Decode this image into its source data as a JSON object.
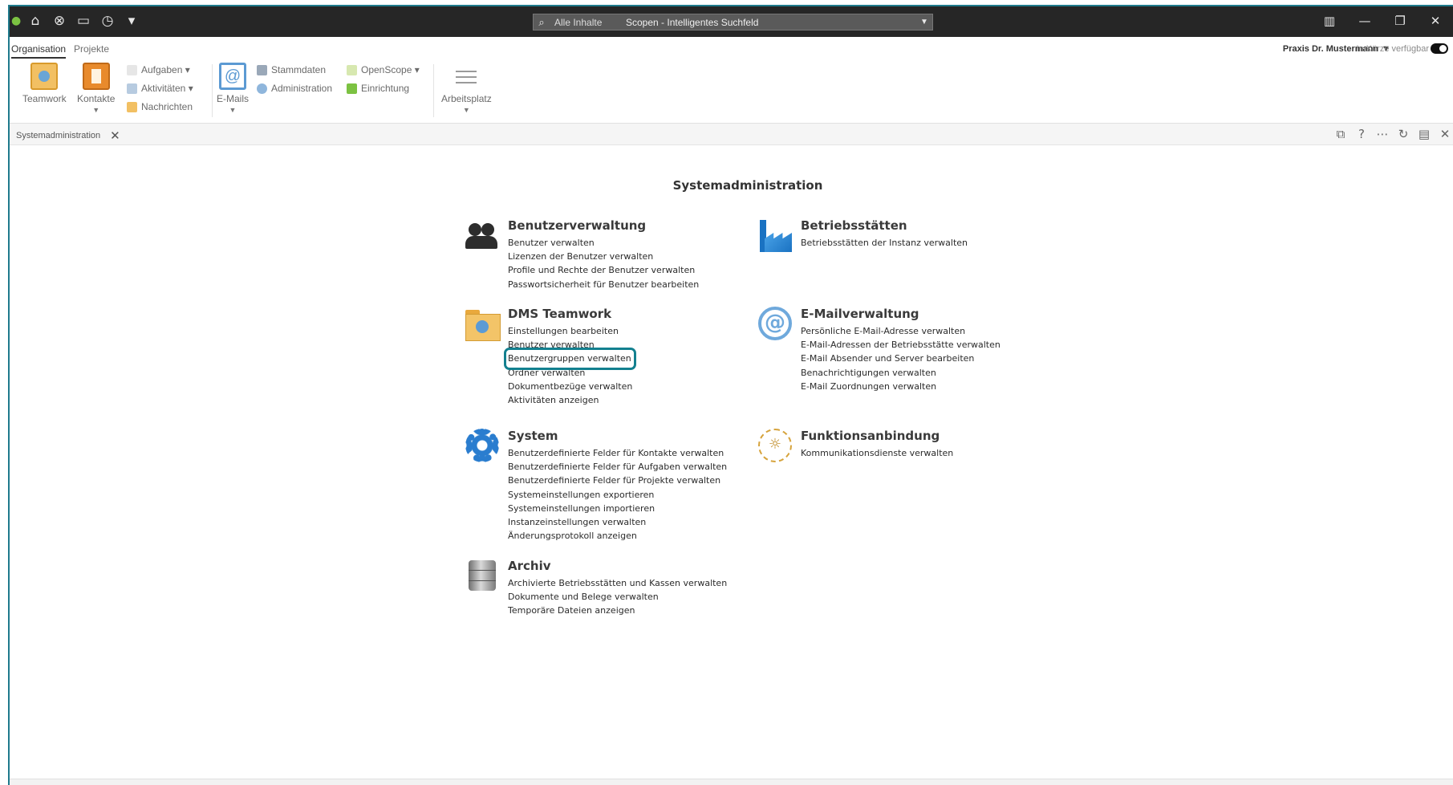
{
  "titlebar": {
    "quick_access_icons": [
      "user-status-icon",
      "home-icon",
      "support-icon",
      "chat-icon",
      "clock-icon",
      "customize-icon"
    ],
    "search": {
      "scope": "Alle Inhalte",
      "placeholder": "Scopen - Intelligentes Suchfeld"
    },
    "window_controls": [
      "layout-icon",
      "minimize-icon",
      "restore-icon",
      "close-icon"
    ]
  },
  "ribbon_tabs": {
    "organisation": "Organisation",
    "projekte": "Projekte"
  },
  "user": {
    "name": "Praxis Dr. Mustermann",
    "caret": "▼",
    "availability": "In Kürze verfügbar"
  },
  "ribbon": {
    "teamwork": "Teamwork",
    "kontakte": "Kontakte",
    "aufgaben": "Aufgaben ▾",
    "aktivitaeten": "Aktivitäten ▾",
    "nachrichten": "Nachrichten",
    "email": "E-Mails",
    "stammdaten": "Stammdaten",
    "administration": "Administration",
    "openscope": "OpenScope ▾",
    "einrichtung": "Einrichtung",
    "arbeitsplatz": "Arbeitsplatz"
  },
  "doctab": {
    "label": "Systemadministration"
  },
  "main": {
    "title": "Systemadministration",
    "sections": [
      {
        "title": "Benutzerverwaltung",
        "icon": "users-icon",
        "items": [
          "Benutzer verwalten",
          "Lizenzen der Benutzer verwalten",
          "Profile und Rechte der Benutzer verwalten",
          "Passwortsicherheit für Benutzer bearbeiten"
        ]
      },
      {
        "title": "Betriebsstätten",
        "icon": "factory-icon",
        "items": [
          "Betriebsstätten der Instanz verwalten"
        ]
      },
      {
        "title": "DMS Teamwork",
        "icon": "folder-icon",
        "items": [
          "Einstellungen bearbeiten",
          "Benutzer verwalten",
          "Benutzergruppen verwalten",
          "Ordner verwalten",
          "Dokumentbezüge verwalten",
          "Aktivitäten anzeigen"
        ]
      },
      {
        "title": "E-Mailverwaltung",
        "icon": "at-icon",
        "items": [
          "Persönliche E-Mail-Adresse verwalten",
          "E-Mail-Adressen der Betriebsstätte verwalten",
          "E-Mail Absender und Server bearbeiten",
          "Benachrichtigungen verwalten",
          "E-Mail Zuordnungen verwalten"
        ]
      },
      {
        "title": "System",
        "icon": "gear-icon",
        "items": [
          "Benutzerdefinierte Felder für Kontakte verwalten",
          "Benutzerdefinierte Felder für Aufgaben verwalten",
          "Benutzerdefinierte Felder für Projekte verwalten",
          "Systemeinstellungen exportieren",
          "Systemeinstellungen importieren",
          "Instanzeinstellungen verwalten",
          "Änderungsprotokoll anzeigen"
        ]
      },
      {
        "title": "Funktionsanbindung",
        "icon": "plug-icon",
        "items": [
          "Kommunikationsdienste verwalten"
        ]
      },
      {
        "title": "Archiv",
        "icon": "archive-icon",
        "items": [
          "Archivierte Betriebsstätten und Kassen verwalten",
          "Dokumente und Belege verwalten",
          "Temporäre Dateien anzeigen"
        ]
      }
    ]
  }
}
